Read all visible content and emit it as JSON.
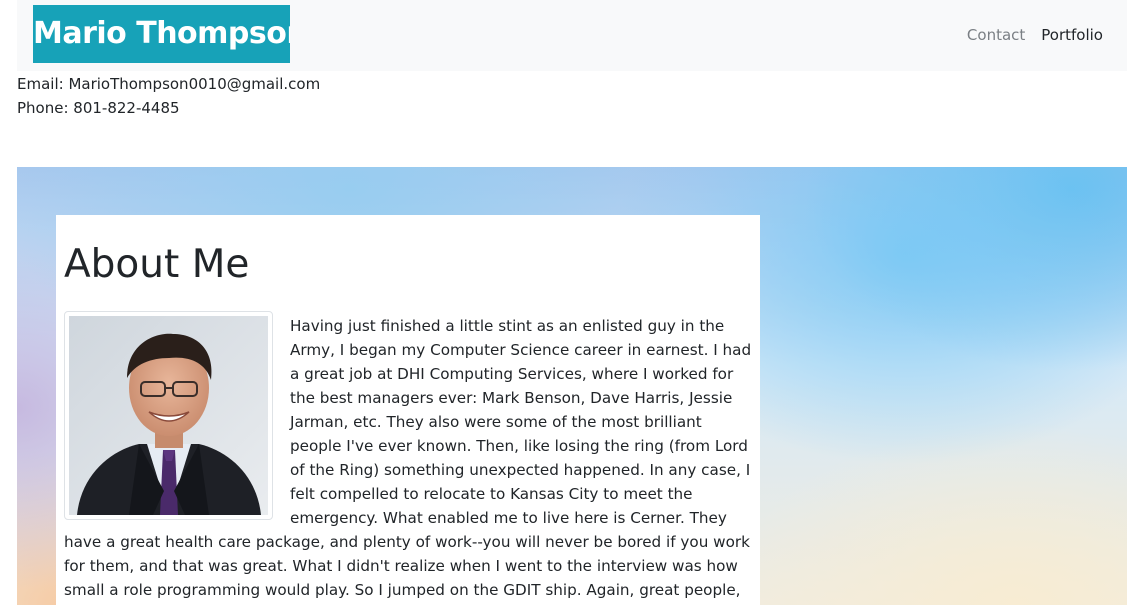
{
  "navbar": {
    "brand": "Mario Thompson",
    "links": [
      {
        "label": "Contact",
        "active": false
      },
      {
        "label": "Portfolio",
        "active": true
      }
    ]
  },
  "contact": {
    "email": "Email: MarioThompson0010@gmail.com",
    "phone": "Phone: 801-822-4485"
  },
  "about": {
    "title": "About Me",
    "bio": "Having just finished a little stint as an enlisted guy in the Army, I began my Computer Science career in earnest. I had a great job at DHI Computing Services, where I worked for the best managers ever: Mark Benson, Dave Harris, Jessie Jarman, etc. They also were some of the most brilliant people I've ever known. Then, like losing the ring (from Lord of the Ring) something unexpected happened. In any case, I felt compelled to relocate to Kansas City to meet the emergency. What enabled me to live here is Cerner. They have a great health care package, and plenty of work--you will never be bored if you work for them, and that was great. What I didn't realize when I went to the interview was how small a role programming would play. So I jumped on the GDIT ship. Again, great people, great company. So, I have approximately spent the following"
  },
  "colors": {
    "brand_background": "#17a2b8",
    "navbar_background": "#f8f9fa",
    "nav_link_muted": "#7a7f84",
    "nav_link_active": "#212529"
  }
}
